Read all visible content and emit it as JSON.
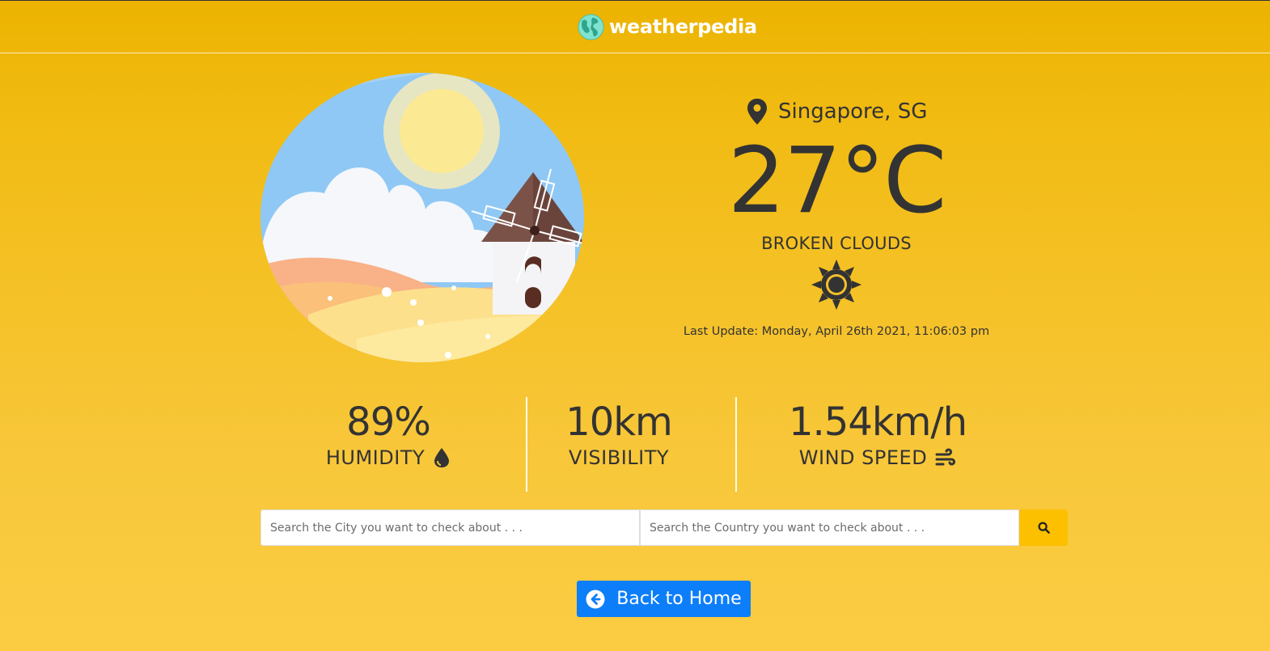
{
  "header": {
    "brand": "weatherpedia",
    "logo_icon": "globe-icon"
  },
  "weather": {
    "location_icon": "map-pin-icon",
    "location": "Singapore, SG",
    "temperature": "27°C",
    "condition": "BROKEN CLOUDS",
    "condition_icon": "sun-icon",
    "last_update": "Last Update: Monday, April 26th 2021, 11:06:03 pm"
  },
  "stats": {
    "humidity": {
      "value": "89%",
      "label": "HUMIDITY",
      "icon": "droplet-icon"
    },
    "visibility": {
      "value": "10km",
      "label": "VISIBILITY"
    },
    "wind": {
      "value": "1.54km/h",
      "label": "WIND SPEED",
      "icon": "wind-icon"
    }
  },
  "search": {
    "city_placeholder": "Search the City you want to check about . . .",
    "country_placeholder": "Search the Country you want to check about . . .",
    "button_icon": "search-icon"
  },
  "home_button": {
    "label": "Back to Home",
    "icon": "arrow-circle-left-icon"
  },
  "colors": {
    "background_top": "#ecb300",
    "background_bottom": "#fbcc42",
    "text": "#333333",
    "search_button": "#fcc000",
    "home_button": "#0d7ef9"
  }
}
